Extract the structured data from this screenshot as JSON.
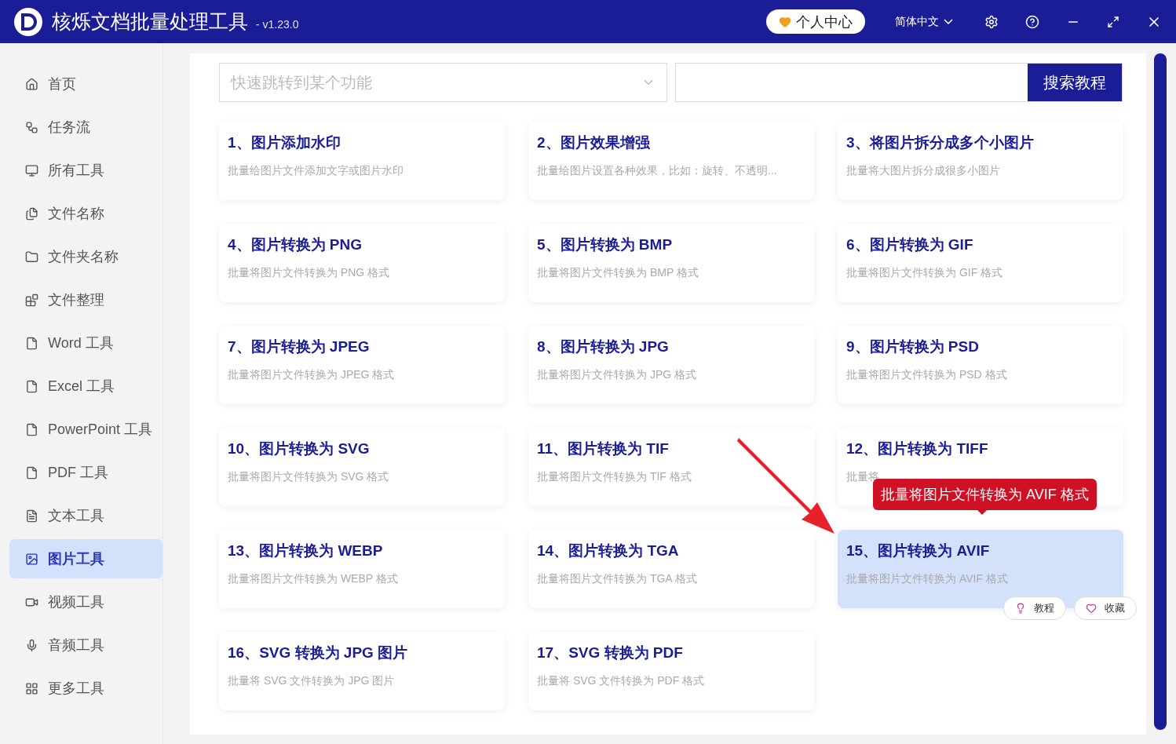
{
  "app": {
    "title": "核烁文档批量处理工具",
    "version": "- v1.23.0"
  },
  "header": {
    "account_button": "个人中心",
    "language": "简体中文"
  },
  "sidebar": {
    "items": [
      {
        "label": "首页",
        "selected": false
      },
      {
        "label": "任务流",
        "selected": false
      },
      {
        "label": "所有工具",
        "selected": false
      },
      {
        "label": "文件名称",
        "selected": false
      },
      {
        "label": "文件夹名称",
        "selected": false
      },
      {
        "label": "文件整理",
        "selected": false
      },
      {
        "label": "Word 工具",
        "selected": false
      },
      {
        "label": "Excel 工具",
        "selected": false
      },
      {
        "label": "PowerPoint 工具",
        "selected": false
      },
      {
        "label": "PDF 工具",
        "selected": false
      },
      {
        "label": "文本工具",
        "selected": false
      },
      {
        "label": "图片工具",
        "selected": true
      },
      {
        "label": "视频工具",
        "selected": false
      },
      {
        "label": "音频工具",
        "selected": false
      },
      {
        "label": "更多工具",
        "selected": false
      }
    ]
  },
  "search": {
    "placeholder": "快速跳转到某个功能",
    "tutorial_button": "搜索教程"
  },
  "tools": [
    {
      "title": "1、图片添加水印",
      "description": "批量给图片文件添加文字或图片水印",
      "selected": false
    },
    {
      "title": "2、图片效果增强",
      "description": "批量给图片设置各种效果，比如：旋转、不透明...",
      "selected": false
    },
    {
      "title": "3、将图片拆分成多个小图片",
      "description": "批量将大图片拆分成很多小图片",
      "selected": false
    },
    {
      "title": "4、图片转换为 PNG",
      "description": "批量将图片文件转换为 PNG 格式",
      "selected": false
    },
    {
      "title": "5、图片转换为 BMP",
      "description": "批量将图片文件转换为 BMP 格式",
      "selected": false
    },
    {
      "title": "6、图片转换为 GIF",
      "description": "批量将图片文件转换为 GIF 格式",
      "selected": false
    },
    {
      "title": "7、图片转换为 JPEG",
      "description": "批量将图片文件转换为 JPEG 格式",
      "selected": false
    },
    {
      "title": "8、图片转换为 JPG",
      "description": "批量将图片文件转换为 JPG 格式",
      "selected": false
    },
    {
      "title": "9、图片转换为 PSD",
      "description": "批量将图片文件转换为 PSD 格式",
      "selected": false
    },
    {
      "title": "10、图片转换为 SVG",
      "description": "批量将图片文件转换为 SVG 格式",
      "selected": false
    },
    {
      "title": "11、图片转换为 TIF",
      "description": "批量将图片文件转换为 TIF 格式",
      "selected": false
    },
    {
      "title": "12、图片转换为 TIFF",
      "description": "批量将",
      "selected": false
    },
    {
      "title": "13、图片转换为 WEBP",
      "description": "批量将图片文件转换为 WEBP 格式",
      "selected": false
    },
    {
      "title": "14、图片转换为 TGA",
      "description": "批量将图片文件转换为 TGA 格式",
      "selected": false
    },
    {
      "title": "15、图片转换为 AVIF",
      "description": "批量将图片文件转换为 AVIF 格式",
      "selected": true
    },
    {
      "title": "16、SVG 转换为 JPG 图片",
      "description": "批量将 SVG 文件转换为 JPG 图片",
      "selected": false
    },
    {
      "title": "17、SVG 转换为 PDF",
      "description": "批量将 SVG 文件转换为 PDF 格式",
      "selected": false
    }
  ],
  "hover_tooltip": "批量将图片文件转换为 AVIF 格式",
  "card_actions": [
    "教程",
    "收藏"
  ]
}
